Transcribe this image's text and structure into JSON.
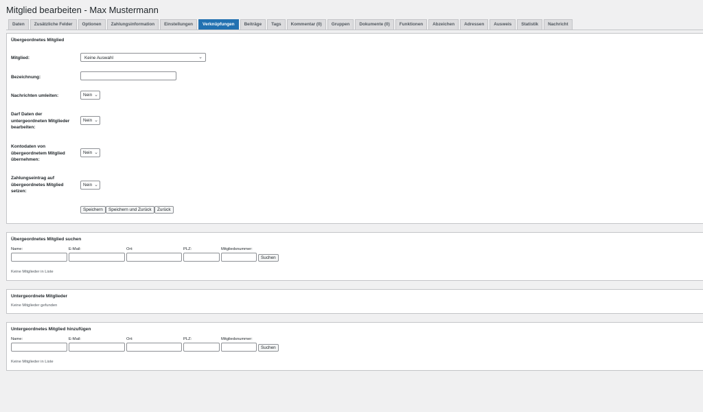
{
  "page_title": "Mitglied bearbeiten - Max Mustermann",
  "tabs": [
    {
      "label": "Daten"
    },
    {
      "label": "Zusätzliche Felder"
    },
    {
      "label": "Optionen"
    },
    {
      "label": "Zahlungsinformation"
    },
    {
      "label": "Einstellungen"
    },
    {
      "label": "Verknüpfungen",
      "active": true
    },
    {
      "label": "Beiträge"
    },
    {
      "label": "Tags"
    },
    {
      "label": "Kommentar (0)"
    },
    {
      "label": "Gruppen"
    },
    {
      "label": "Dokumente (0)"
    },
    {
      "label": "Funktionen"
    },
    {
      "label": "Abzeichen"
    },
    {
      "label": "Adressen"
    },
    {
      "label": "Ausweis"
    },
    {
      "label": "Statistik"
    },
    {
      "label": "Nachricht"
    }
  ],
  "parent_panel": {
    "title": "Übergeordnetes Mitglied",
    "mitglied_label": "Mitglied:",
    "mitglied_value": "Keine Auswahl",
    "bezeichnung_label": "Bezeichnung:",
    "bezeichnung_value": "",
    "nachrichten_label": "Nachrichten umleiten:",
    "nachrichten_value": "Nein",
    "darf_daten_label": "Darf Daten der untergeordneten Mitglieder bearbeiten:",
    "darf_daten_value": "Nein",
    "kontodaten_label": "Kontodaten von übergeordnetem Mitglied übernehmen:",
    "kontodaten_value": "Nein",
    "zahlung_label": "Zahlungseintrag auf übergeordnetes Mitglied setzen:",
    "zahlung_value": "Nein",
    "btn_save": "Speichern",
    "btn_save_back": "Speichern und Zurück",
    "btn_back": "Zurück"
  },
  "search_parent": {
    "title": "Übergeordnetes Mitglied suchen",
    "name_label": "Name:",
    "email_label": "E-Mail:",
    "ort_label": "Ort:",
    "plz_label": "PLZ:",
    "nr_label": "Mitgliedsnummer:",
    "btn": "Suchen",
    "empty": "Keine Mitglieder in Liste"
  },
  "children": {
    "title": "Untergeordnete Mitglieder",
    "empty": "Keine Mitglieder gefunden"
  },
  "add_child": {
    "title": "Untergeordnetes Mitglied hinzufügen",
    "name_label": "Name:",
    "email_label": "E-Mail:",
    "ort_label": "Ort:",
    "plz_label": "PLZ:",
    "nr_label": "Mitgliedsnummer:",
    "btn": "Suchen",
    "empty": "Keine Mitglieder in Liste"
  }
}
